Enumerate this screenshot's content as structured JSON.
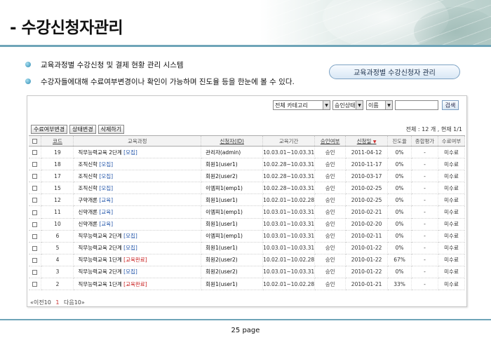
{
  "header": {
    "title": "- 수강신청자관리"
  },
  "bullets": [
    "교육과정별 수강신청 및 결제 현황 관리 시스템",
    "수강자들에대해 수료여부변경이나 확인이 가능하며 진도율 등을 한눈에 볼 수 있다."
  ],
  "pill_label": "교육과정별 수강신청자 관리",
  "filters": {
    "category": "전체 카테고리",
    "status": "승인상태",
    "field": "이름",
    "search_label": "검색"
  },
  "actions": {
    "change_completion": "수료여부변경",
    "change_status": "상태변경",
    "delete": "삭제하기"
  },
  "total_text": "전체 : 12 개 , 현재 1/1",
  "columns": [
    "코드",
    "교육과정",
    "신청자(ID)",
    "교육기간",
    "승인여부",
    "신청일",
    "진도율",
    "종합평가",
    "수료여부"
  ],
  "rows": [
    {
      "code": "19",
      "course": "직무능력교육 2단계",
      "tag": "[모집]",
      "tagtype": "blue",
      "applicant": "관리자(admin)",
      "period": "10.03.01~10.03.31",
      "approval": "승인",
      "date": "2011-04-12",
      "progress": "0%",
      "eval": "-",
      "complete": "미수료"
    },
    {
      "code": "18",
      "course": "조직신학",
      "tag": "[모집]",
      "tagtype": "blue",
      "applicant": "회원1(user1)",
      "period": "10.02.28~10.03.31",
      "approval": "승인",
      "date": "2010-11-17",
      "progress": "0%",
      "eval": "-",
      "complete": "미수료"
    },
    {
      "code": "17",
      "course": "조직신학",
      "tag": "[모집]",
      "tagtype": "blue",
      "applicant": "회원2(user2)",
      "period": "10.02.28~10.03.31",
      "approval": "승인",
      "date": "2010-03-17",
      "progress": "0%",
      "eval": "-",
      "complete": "미수료"
    },
    {
      "code": "15",
      "course": "조직신학",
      "tag": "[모집]",
      "tagtype": "blue",
      "applicant": "이엠피1(emp1)",
      "period": "10.02.28~10.03.31",
      "approval": "승인",
      "date": "2010-02-25",
      "progress": "0%",
      "eval": "-",
      "complete": "미수료"
    },
    {
      "code": "12",
      "course": "구약개론",
      "tag": "[교육]",
      "tagtype": "blue",
      "applicant": "회원1(user1)",
      "period": "10.02.01~10.02.28",
      "approval": "승인",
      "date": "2010-02-25",
      "progress": "0%",
      "eval": "-",
      "complete": "미수료"
    },
    {
      "code": "11",
      "course": "신약개론",
      "tag": "[교육]",
      "tagtype": "blue",
      "applicant": "이엠피1(emp1)",
      "period": "10.03.01~10.03.31",
      "approval": "승인",
      "date": "2010-02-21",
      "progress": "0%",
      "eval": "-",
      "complete": "미수료"
    },
    {
      "code": "10",
      "course": "신약개론",
      "tag": "[교육]",
      "tagtype": "blue",
      "applicant": "회원1(user1)",
      "period": "10.03.01~10.03.31",
      "approval": "승인",
      "date": "2010-02-20",
      "progress": "0%",
      "eval": "-",
      "complete": "미수료"
    },
    {
      "code": "6",
      "course": "직무능력교육 2단계",
      "tag": "[모집]",
      "tagtype": "blue",
      "applicant": "이엠피1(emp1)",
      "period": "10.03.01~10.03.31",
      "approval": "승인",
      "date": "2010-02-11",
      "progress": "0%",
      "eval": "-",
      "complete": "미수료"
    },
    {
      "code": "5",
      "course": "직무능력교육 2단계",
      "tag": "[모집]",
      "tagtype": "blue",
      "applicant": "회원1(user1)",
      "period": "10.03.01~10.03.31",
      "approval": "승인",
      "date": "2010-01-22",
      "progress": "0%",
      "eval": "-",
      "complete": "미수료"
    },
    {
      "code": "4",
      "course": "직무능력교육 1단계",
      "tag": "[교육완료]",
      "tagtype": "red",
      "applicant": "회원2(user2)",
      "period": "10.02.01~10.02.28",
      "approval": "승인",
      "date": "2010-01-22",
      "progress": "67%",
      "eval": "-",
      "complete": "미수료"
    },
    {
      "code": "3",
      "course": "직무능력교육 2단계",
      "tag": "[모집]",
      "tagtype": "blue",
      "applicant": "회원2(user2)",
      "period": "10.03.01~10.03.31",
      "approval": "승인",
      "date": "2010-01-22",
      "progress": "0%",
      "eval": "-",
      "complete": "미수료"
    },
    {
      "code": "2",
      "course": "직무능력교육 1단계",
      "tag": "[교육완료]",
      "tagtype": "red",
      "applicant": "회원1(user1)",
      "period": "10.02.01~10.02.28",
      "approval": "승인",
      "date": "2010-01-21",
      "progress": "33%",
      "eval": "-",
      "complete": "미수료"
    }
  ],
  "pager": {
    "prev": "«이전10",
    "current": "1",
    "next": "다음10»"
  },
  "footer": {
    "page": "25 page"
  }
}
